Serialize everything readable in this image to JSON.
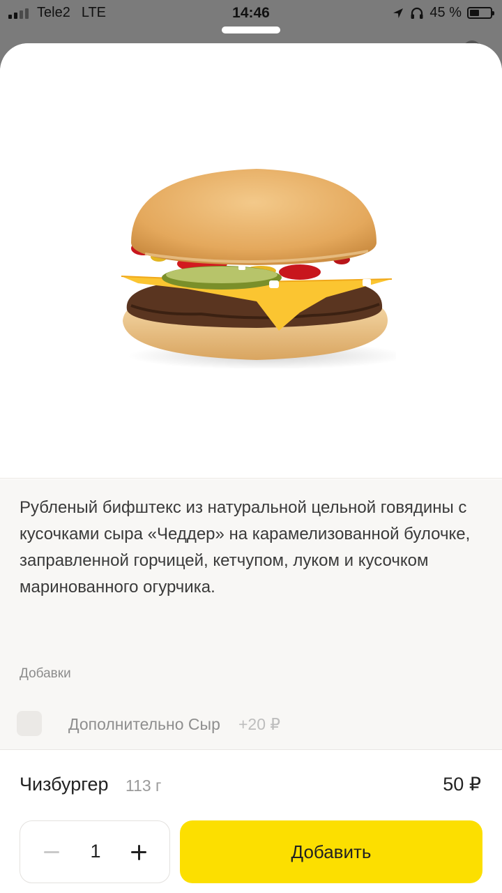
{
  "status_bar": {
    "carrier": "Tele2",
    "network": "LTE",
    "time": "14:46",
    "battery_text": "45 %",
    "battery_level": 0.45
  },
  "product": {
    "image_icon": "cheeseburger-image",
    "description": "Рубленый бифштекс из натуральной цельной говядины с кусочками сыра «Чеддер» на карамелизованной булочке, заправленной горчицей, кетчупом, луком и кусочком маринованного огурчика.",
    "addons_title": "Добавки",
    "addons": [
      {
        "name": "Дополнительно Сыр",
        "price": "+20 ₽",
        "checked": false
      }
    ],
    "name": "Чизбургер",
    "weight": "113 г",
    "price": "50 ₽"
  },
  "order": {
    "quantity": "1",
    "add_label": "Добавить"
  },
  "colors": {
    "accent": "#fcdf00",
    "overlay": "#7b7b7b"
  }
}
